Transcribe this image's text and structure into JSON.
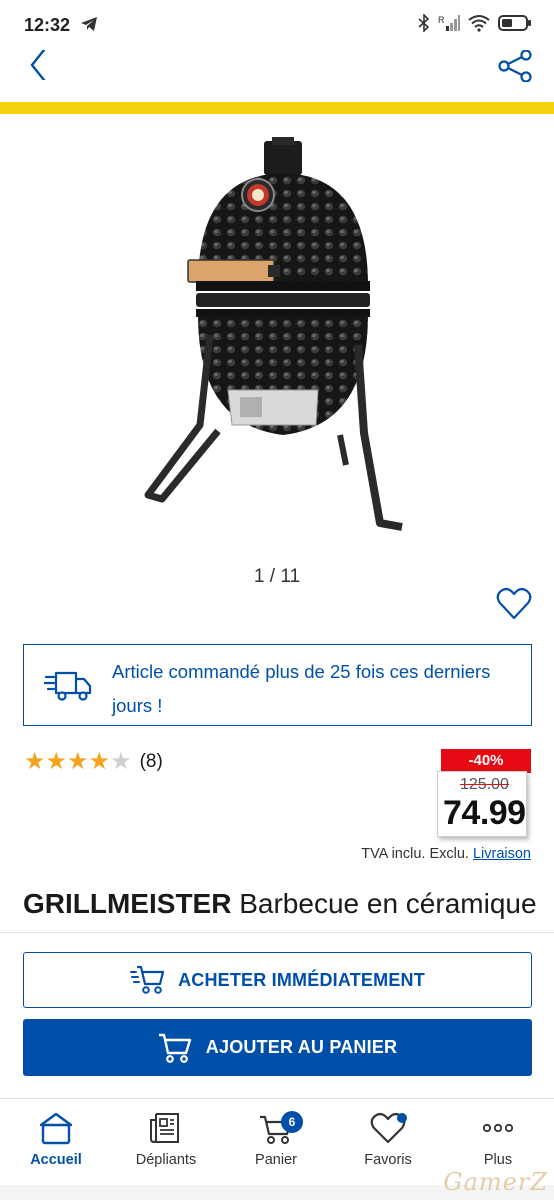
{
  "status_bar": {
    "time": "12:32",
    "icons": [
      "telegram-icon",
      "bluetooth-icon",
      "signal-icon",
      "wifi-icon",
      "battery-icon"
    ]
  },
  "header": {
    "back_icon": "chevron-left-icon",
    "share_icon": "share-icon"
  },
  "colors": {
    "brand_blue": "#0050aa",
    "brand_yellow": "#f5d10e",
    "discount_red": "#e60a14",
    "star_yellow": "#f3a51f"
  },
  "product": {
    "image_counter": "1 / 11",
    "image_icon": "kamado-grill-image",
    "info_message": "Article commandé plus de 25 fois ces derniers jours !",
    "rating": 4,
    "rating_max": 5,
    "rating_count": "(8)",
    "discount": "-40%",
    "old_price": "125.00",
    "new_price": "74.99",
    "tax_text": "TVA inclu. Exclu.",
    "delivery_link": "Livraison",
    "brand": "GRILLMEISTER",
    "name": "Barbecue en céramique"
  },
  "actions": {
    "buy_now": "ACHETER IMMÉDIATEMENT",
    "add_to_cart": "AJOUTER AU PANIER"
  },
  "bottom_nav": {
    "items": [
      {
        "label": "Accueil",
        "icon": "home-icon",
        "active": true
      },
      {
        "label": "Dépliants",
        "icon": "leaflet-icon",
        "active": false
      },
      {
        "label": "Panier",
        "icon": "cart-icon",
        "badge": "6",
        "active": false
      },
      {
        "label": "Favoris",
        "icon": "heart-icon",
        "active": false
      },
      {
        "label": "Plus",
        "icon": "more-icon",
        "active": false
      }
    ]
  },
  "watermark": "GamerZ"
}
